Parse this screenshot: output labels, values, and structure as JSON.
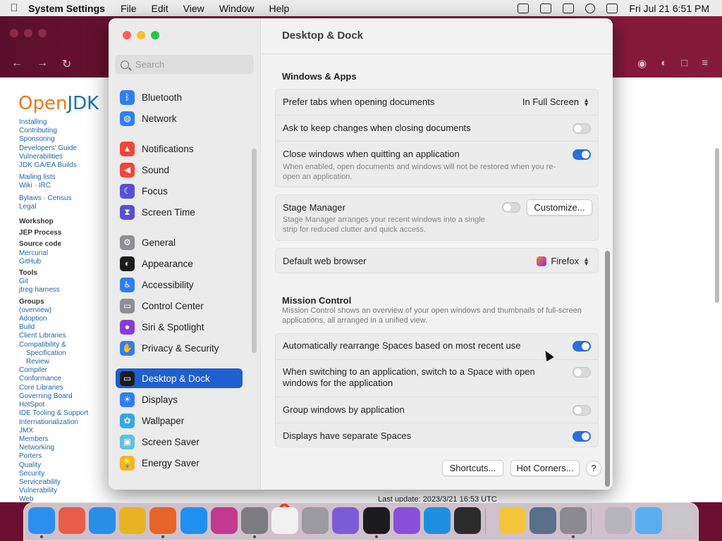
{
  "menubar": {
    "app_name": "System Settings",
    "menus": [
      "File",
      "Edit",
      "View",
      "Window",
      "Help"
    ],
    "datetime": "Fri Jul 21  6:51 PM"
  },
  "background_browser": {
    "logo_open": "Open",
    "logo_jdk": "JDK",
    "nav_links": [
      {
        "text": "Installing"
      },
      {
        "text": "Contributing"
      },
      {
        "text": "Sponsoring"
      },
      {
        "text": "Developers' Guide"
      },
      {
        "text": "Vulnerabilities"
      },
      {
        "text": "JDK GA/EA Builds"
      },
      {
        "gap": true
      },
      {
        "text": "Mailing lists"
      },
      {
        "text": "Wiki · IRC"
      },
      {
        "gap": true
      },
      {
        "text": "Bylaws · Census"
      },
      {
        "text": "Legal"
      },
      {
        "gap": true
      },
      {
        "text": "Workshop",
        "heading": true
      },
      {
        "text": "JEP Process",
        "heading": true
      },
      {
        "text": "Source code",
        "heading": true
      },
      {
        "text": "Mercurial"
      },
      {
        "text": "GitHub"
      },
      {
        "text": "Tools",
        "heading": true
      },
      {
        "text": "Git"
      },
      {
        "text": "jtreg harness"
      },
      {
        "text": "Groups",
        "heading": true
      },
      {
        "text": "(overview)"
      },
      {
        "text": "Adoption"
      },
      {
        "text": "Build"
      },
      {
        "text": "Client Libraries"
      },
      {
        "text": "Compatibility &"
      },
      {
        "text": "Specification",
        "sub": true
      },
      {
        "text": "Review",
        "sub": true
      },
      {
        "text": "Compiler"
      },
      {
        "text": "Conformance"
      },
      {
        "text": "Core Libraries"
      },
      {
        "text": "Governing Board"
      },
      {
        "text": "HotSpot"
      },
      {
        "text": "IDE Tooling & Support"
      },
      {
        "text": "Internationalization"
      },
      {
        "text": "JMX"
      },
      {
        "text": "Members"
      },
      {
        "text": "Networking"
      },
      {
        "text": "Porters"
      },
      {
        "text": "Quality"
      },
      {
        "text": "Security"
      },
      {
        "text": "Serviceability"
      },
      {
        "text": "Vulnerability"
      },
      {
        "text": "Web"
      }
    ],
    "footer_text": "Last update: 2023/3/21 16:53 UTC"
  },
  "settings": {
    "search_placeholder": "Search",
    "sidebar_items": [
      {
        "label": "Bluetooth",
        "icon": "bluetooth-icon",
        "color": "#2f7ff0",
        "glyph": "ᛒ"
      },
      {
        "label": "Network",
        "icon": "globe-icon",
        "color": "#2f7ff0",
        "glyph": "◍"
      },
      {
        "label": "Notifications",
        "icon": "bell-icon",
        "color": "#f0453a",
        "glyph": "▲"
      },
      {
        "label": "Sound",
        "icon": "speaker-icon",
        "color": "#f0453a",
        "glyph": "◀"
      },
      {
        "label": "Focus",
        "icon": "moon-icon",
        "color": "#5a4fd6",
        "glyph": "☾"
      },
      {
        "label": "Screen Time",
        "icon": "hourglass-icon",
        "color": "#5a4fd6",
        "glyph": "⧗"
      },
      {
        "label": "General",
        "icon": "gear-icon",
        "color": "#8e8e93",
        "glyph": "⚙"
      },
      {
        "label": "Appearance",
        "icon": "appearance-icon",
        "color": "#1c1c1e",
        "glyph": "◐"
      },
      {
        "label": "Accessibility",
        "icon": "accessibility-icon",
        "color": "#2f7ff0",
        "glyph": "♿"
      },
      {
        "label": "Control Center",
        "icon": "control-center-icon",
        "color": "#8e8e93",
        "glyph": "▭"
      },
      {
        "label": "Siri & Spotlight",
        "icon": "siri-icon",
        "color": "#8a3bd6",
        "glyph": "●"
      },
      {
        "label": "Privacy & Security",
        "icon": "hand-icon",
        "color": "#2f7ff0",
        "glyph": "✋"
      },
      {
        "label": "Desktop & Dock",
        "icon": "dock-icon",
        "color": "#1c1c1e",
        "glyph": "▭",
        "selected": true
      },
      {
        "label": "Displays",
        "icon": "sun-icon",
        "color": "#2f7ff0",
        "glyph": "☀"
      },
      {
        "label": "Wallpaper",
        "icon": "flower-icon",
        "color": "#37a6e6",
        "glyph": "✿"
      },
      {
        "label": "Screen Saver",
        "icon": "screensaver-icon",
        "color": "#5bc0e0",
        "glyph": "▣"
      },
      {
        "label": "Energy Saver",
        "icon": "bulb-icon",
        "color": "#f5b324",
        "glyph": "💡"
      }
    ],
    "page_title": "Desktop & Dock",
    "windows_apps": {
      "title": "Windows & Apps",
      "prefer_tabs_label": "Prefer tabs when opening documents",
      "prefer_tabs_value": "In Full Screen",
      "ask_keep_label": "Ask to keep changes when closing documents",
      "ask_keep_on": false,
      "close_windows_label": "Close windows when quitting an application",
      "close_windows_desc": "When enabled, open documents and windows will not be restored when you re-open an application.",
      "close_windows_on": true
    },
    "stage_manager": {
      "label": "Stage Manager",
      "desc": "Stage Manager arranges your recent windows into a single strip for reduced clutter and quick access.",
      "on": false,
      "customize_label": "Customize..."
    },
    "browser": {
      "label": "Default web browser",
      "value": "Firefox"
    },
    "mission_control": {
      "title": "Mission Control",
      "desc": "Mission Control shows an overview of your open windows and thumbnails of full-screen applications, all arranged in a unified view.",
      "rearrange_label": "Automatically rearrange Spaces based on most recent use",
      "rearrange_on": true,
      "switch_label": "When switching to an application, switch to a Space with open windows for the application",
      "switch_on": false,
      "group_label": "Group windows by application",
      "group_on": false,
      "separate_label": "Displays have separate Spaces",
      "separate_on": true
    },
    "shortcuts_label": "Shortcuts...",
    "hot_corners_label": "Hot Corners...",
    "help_label": "?"
  },
  "dock": {
    "badge_count": "2",
    "apps": [
      {
        "name": "finder",
        "color": "#2b8ff0"
      },
      {
        "name": "launchpad",
        "color": "#e85d4a"
      },
      {
        "name": "safari",
        "color": "#2a8de8"
      },
      {
        "name": "chrome",
        "color": "#e8b323"
      },
      {
        "name": "firefox",
        "color": "#e8632a"
      },
      {
        "name": "app-store",
        "color": "#1f8ff0"
      },
      {
        "name": "shortcuts",
        "color": "#c13a8f"
      },
      {
        "name": "system-settings",
        "color": "#7b7b80"
      },
      {
        "name": "textedit",
        "color": "#f0f0f0"
      },
      {
        "name": "screenshot",
        "color": "#9a9aa0"
      },
      {
        "name": "pinta",
        "color": "#7c5bd6"
      },
      {
        "name": "terminal",
        "color": "#1c1c1e"
      },
      {
        "name": "visual-studio",
        "color": "#8a4fd8"
      },
      {
        "name": "vscode",
        "color": "#1f8fe0"
      },
      {
        "name": "museum",
        "color": "#2b2b2b"
      },
      {
        "name": "color-picker",
        "color": "#f2c53a"
      },
      {
        "name": "preview",
        "color": "#5a6f8a"
      },
      {
        "name": "disk-utility",
        "color": "#8a8a90"
      },
      {
        "name": "help",
        "color": "#b5b5bb"
      },
      {
        "name": "folder",
        "color": "#59aef0"
      },
      {
        "name": "trash",
        "color": "#c8c8cc"
      }
    ]
  }
}
